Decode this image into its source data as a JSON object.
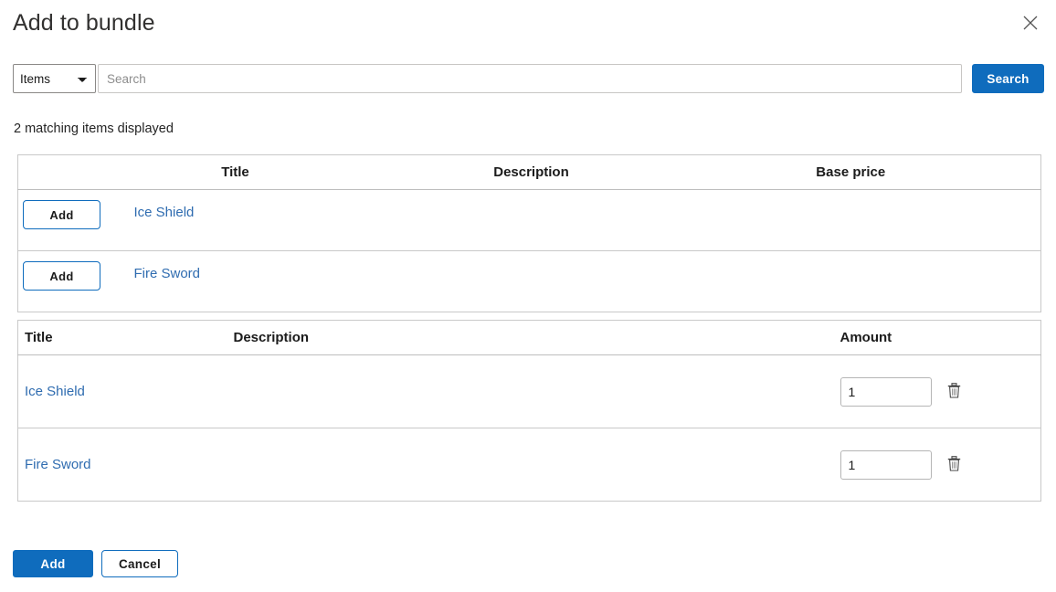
{
  "dialog": {
    "title": "Add to bundle",
    "close_icon": "close-icon"
  },
  "search": {
    "type_selected": "Items",
    "type_options": [
      "Items"
    ],
    "placeholder": "Search",
    "value": "",
    "button_label": "Search",
    "accent_color": "#0f6cbd"
  },
  "results": {
    "count_text": "2 matching items displayed",
    "columns": [
      "",
      "Title",
      "Description",
      "Base price"
    ],
    "rows": [
      {
        "action_label": "Add",
        "title": "Ice Shield",
        "description": "",
        "base_price": ""
      },
      {
        "action_label": "Add",
        "title": "Fire Sword",
        "description": "",
        "base_price": ""
      }
    ]
  },
  "selected": {
    "columns": [
      "Title",
      "Description",
      "Amount"
    ],
    "rows": [
      {
        "title": "Ice Shield",
        "description": "",
        "amount": "1",
        "delete_icon": "trash-icon"
      },
      {
        "title": "Fire Sword",
        "description": "",
        "amount": "1",
        "delete_icon": "trash-icon"
      }
    ]
  },
  "footer": {
    "submit_label": "Add",
    "cancel_label": "Cancel"
  },
  "colors": {
    "accent": "#0f6cbd",
    "link": "#2f6cb0",
    "border": "#c9c9c9",
    "text": "#212121"
  }
}
